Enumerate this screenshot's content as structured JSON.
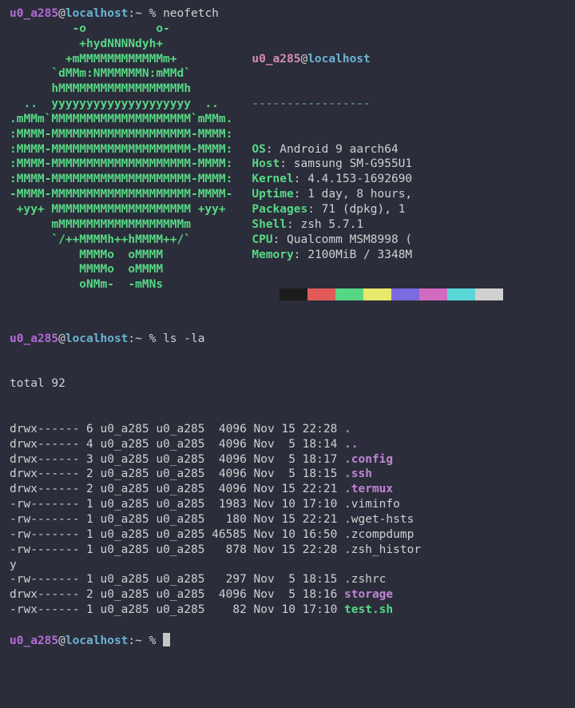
{
  "prompt": {
    "user": "u0_a285",
    "at": "@",
    "host": "localhost",
    "tail": ":~ % "
  },
  "cmd1": "neofetch",
  "ascii_logo": "         -o          o-         \n          +hydNNNNdyh+          \n        +mMMMMMMMMMMMMm+        \n      `dMMm:NMMMMMMN:mMMd`      \n      hMMMMMMMMMMMMMMMMMMh      \n  ..  yyyyyyyyyyyyyyyyyyyy  ..  \n.mMMm`MMMMMMMMMMMMMMMMMMMM`mMMm.\n:MMMM-MMMMMMMMMMMMMMMMMMMM-MMMM:\n:MMMM-MMMMMMMMMMMMMMMMMMMM-MMMM:\n:MMMM-MMMMMMMMMMMMMMMMMMMM-MMMM:\n:MMMM-MMMMMMMMMMMMMMMMMMMM-MMMM:\n-MMMM-MMMMMMMMMMMMMMMMMMMM-MMMM-\n +yy+ MMMMMMMMMMMMMMMMMMMM +yy+ \n      mMMMMMMMMMMMMMMMMMMm      \n      `/++MMMMh++hMMMM++/`      \n          MMMMo  oMMMM          \n          MMMMo  oMMMM          \n          oNMm-  -mMNs          ",
  "info_header": {
    "user": "u0_a285",
    "host": "localhost"
  },
  "info_dash": "-----------------",
  "info_rows": [
    {
      "label": "OS",
      "value": "Android 9 aarch64"
    },
    {
      "label": "Host",
      "value": "samsung SM-G955U1"
    },
    {
      "label": "Kernel",
      "value": "4.4.153-1692690"
    },
    {
      "label": "Uptime",
      "value": "1 day, 8 hours,"
    },
    {
      "label": "Packages",
      "value": "71 (dpkg), 1"
    },
    {
      "label": "Shell",
      "value": "zsh 5.7.1"
    },
    {
      "label": "CPU",
      "value": "Qualcomm MSM8998 ("
    },
    {
      "label": "Memory",
      "value": "2100MiB / 3348M"
    }
  ],
  "palette": [
    "#1c1c1c",
    "#e05a5a",
    "#57d785",
    "#e8e86a",
    "#7a6be0",
    "#d06bc0",
    "#5ad7d7",
    "#d0d0d0"
  ],
  "cmd2": "ls -la",
  "ls_total": "total 92",
  "ls_rows": [
    {
      "line": "drwx------ 6 u0_a285 u0_a285  4096 Nov 15 22:28 ",
      "name": ".",
      "cls": "fname-dir"
    },
    {
      "line": "drwx------ 4 u0_a285 u0_a285  4096 Nov  5 18:14 ",
      "name": "..",
      "cls": "fname-dir"
    },
    {
      "line": "drwx------ 3 u0_a285 u0_a285  4096 Nov  5 18:17 ",
      "name": ".config",
      "cls": "fname-dir"
    },
    {
      "line": "drwx------ 2 u0_a285 u0_a285  4096 Nov  5 18:15 ",
      "name": ".ssh",
      "cls": "fname-dir"
    },
    {
      "line": "drwx------ 2 u0_a285 u0_a285  4096 Nov 15 22:21 ",
      "name": ".termux",
      "cls": "fname-dir"
    },
    {
      "line": "-rw------- 1 u0_a285 u0_a285  1983 Nov 10 17:10 ",
      "name": ".viminfo",
      "cls": "fname-reg"
    },
    {
      "line": "-rw------- 1 u0_a285 u0_a285   180 Nov 15 22:21 ",
      "name": ".wget-hsts",
      "cls": "fname-reg"
    },
    {
      "line": "-rw------- 1 u0_a285 u0_a285 46585 Nov 10 16:50 ",
      "name": ".zcompdump",
      "cls": "fname-reg"
    },
    {
      "line": "-rw------- 1 u0_a285 u0_a285   878 Nov 15 22:28 ",
      "name": ".zsh_histor",
      "cls": "fname-reg",
      "wrap": "y"
    },
    {
      "line": "-rw------- 1 u0_a285 u0_a285   297 Nov  5 18:15 ",
      "name": ".zshrc",
      "cls": "fname-reg"
    },
    {
      "line": "drwx------ 2 u0_a285 u0_a285  4096 Nov  5 18:16 ",
      "name": "storage",
      "cls": "fname-dir"
    },
    {
      "line": "-rwx------ 1 u0_a285 u0_a285    82 Nov 10 17:10 ",
      "name": "test.sh",
      "cls": "fname-exec"
    }
  ]
}
